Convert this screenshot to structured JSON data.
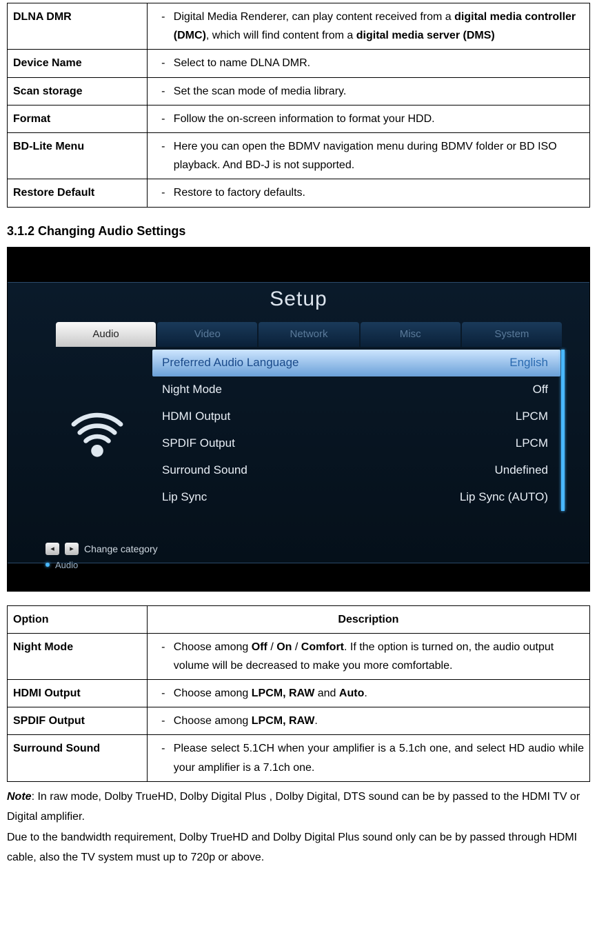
{
  "table1": {
    "rows": [
      {
        "name": "DLNA DMR",
        "desc_pre": "Digital Media Renderer, can play content received from a ",
        "b1": "digital media controller (DMC)",
        "desc_mid": ", which will find content from a ",
        "b2": "digital media server (DMS)"
      },
      {
        "name": "Device Name",
        "desc": "Select to name DLNA DMR."
      },
      {
        "name": "Scan storage",
        "desc": "Set the scan mode of media library."
      },
      {
        "name": "Format",
        "desc": "Follow the on-screen information to format your HDD."
      },
      {
        "name": "BD-Lite Menu",
        "desc": "Here you can open the BDMV navigation menu during BDMV folder or BD ISO playback. And BD-J is not supported."
      },
      {
        "name": "Restore Default",
        "desc": "Restore to factory defaults."
      }
    ]
  },
  "section_title": "3.1.2 Changing Audio Settings",
  "setup": {
    "title": "Setup",
    "tabs": [
      "Audio",
      "Video",
      "Network",
      "Misc",
      "System"
    ],
    "rows": [
      {
        "label": "Preferred Audio Language",
        "value": "English",
        "hl": true
      },
      {
        "label": "Night Mode",
        "value": "Off"
      },
      {
        "label": "HDMI Output",
        "value": "LPCM"
      },
      {
        "label": "SPDIF Output",
        "value": "LPCM"
      },
      {
        "label": "Surround Sound",
        "value": "Undefined"
      },
      {
        "label": "Lip Sync",
        "value": "Lip Sync (AUTO)"
      }
    ],
    "hint": "Change category",
    "sub": "Audio"
  },
  "table2": {
    "header_option": "Option",
    "header_desc": "Description",
    "rows": [
      {
        "name": "Night Mode",
        "pre": "Choose among ",
        "b1": "Off",
        "sep1": " / ",
        "b2": "On",
        "sep2": " / ",
        "b3": "Comfort",
        "post": ". If the option is turned on, the audio output volume will be decreased to make you more comfortable."
      },
      {
        "name": "HDMI Output",
        "pre": "Choose among ",
        "b1": "LPCM, RAW",
        "sep1": " and ",
        "b2": "Auto",
        "post": "."
      },
      {
        "name": "SPDIF Output",
        "pre": "Choose among ",
        "b1": "LPCM, RAW",
        "post": "."
      },
      {
        "name": "Surround Sound",
        "desc": "Please select 5.1CH when your amplifier is a 5.1ch one, and select HD audio while your amplifier is a 7.1ch one."
      }
    ]
  },
  "note": {
    "label": "Note",
    "p1": ": In raw mode, Dolby TrueHD, Dolby Digital Plus , Dolby Digital, DTS sound can be by passed to the HDMI TV or Digital amplifier.",
    "p2": "Due to the bandwidth requirement, Dolby TrueHD and Dolby Digital Plus sound only can be by passed through HDMI cable, also the TV system must up to 720p or above."
  }
}
